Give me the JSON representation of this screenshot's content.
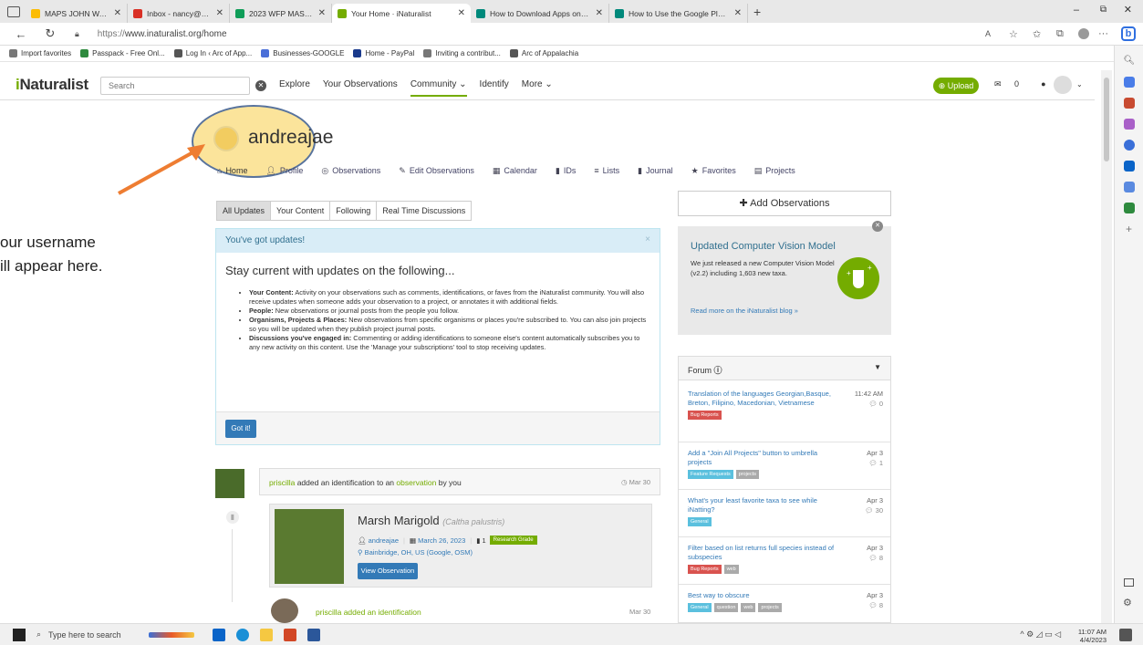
{
  "browser": {
    "tabs": [
      {
        "label": "MAPS JOHN WALSH - Google D",
        "color": "#fbbc04"
      },
      {
        "label": "Inbox - nancy@arcofappalachia.",
        "color": "#d93025"
      },
      {
        "label": "2023 WFP MASTER PLANNING",
        "color": "#0f9d58"
      },
      {
        "label": "Your Home · iNaturalist",
        "color": "#74ac00"
      },
      {
        "label": "How to Download Apps on Andr",
        "color": "#00897b"
      },
      {
        "label": "How to Use the Google Play Sto",
        "color": "#00897b"
      }
    ],
    "url_scheme": "https://",
    "url_rest": "www.inaturalist.org/home",
    "favorites": [
      "Import favorites",
      "Passpack - Free Onl...",
      "Log In ‹ Arc of App...",
      "Businesses-GOOGLE",
      "Home - PayPal",
      "Inviting a contribut...",
      "Arc of Appalachia"
    ]
  },
  "header": {
    "logo_i": "i",
    "logo_rest": "Naturalist",
    "search_placeholder": "Search",
    "nav": [
      "Explore",
      "Your Observations",
      "Community ⌄",
      "Identify",
      "More ⌄"
    ],
    "upload_label": "Upload",
    "messages_count": "0",
    "notifications_count": "0"
  },
  "profile": {
    "username": "andreajae",
    "subnav": [
      "Home",
      "Profile",
      "Observations",
      "Edit Observations",
      "Calendar",
      "IDs",
      "Lists",
      "Journal",
      "Favorites",
      "Projects"
    ]
  },
  "annotation": {
    "line1": "our username",
    "line2": "ill appear here."
  },
  "updates": {
    "tabs": [
      "All Updates",
      "Your Content",
      "Following",
      "Real Time Discussions"
    ],
    "header": "You've got updates!",
    "title": "Stay current with updates on the following...",
    "items": [
      {
        "bold": "Your Content:",
        "text": " Activity on your observations such as comments, identifications, or faves from the iNaturalist community. You will also receive updates when someone adds your observation to a project, or annotates it with additional fields."
      },
      {
        "bold": "People:",
        "text": " New observations or journal posts from the people you follow."
      },
      {
        "bold": "Organisms, Projects & Places:",
        "text": " New observations from specific organisms or places you're subscribed to. You can also join projects so you will be updated when they publish project journal posts."
      },
      {
        "bold": "Discussions you've engaged in:",
        "text": " Commenting or adding identifications to someone else's content automatically subscribes you to any new activity on this content. Use the 'Manage your subscriptions' tool to stop receiving updates."
      }
    ],
    "button": "Got it!"
  },
  "feed": {
    "item1": {
      "user": "priscilla",
      "mid": " added an identification to an ",
      "link": "observation",
      "end": " by you",
      "date": "Mar 30"
    },
    "obs": {
      "name": "Marsh Marigold",
      "sci": "(Caltha palustris)",
      "user": "andreajae",
      "date": "March 26, 2023",
      "ids": "1",
      "grade": "Research Grade",
      "place": "Bainbridge, OH, US (Google, OSM)",
      "button": "View Observation"
    },
    "item2": {
      "text": "priscilla added an identification",
      "date": "Mar 30"
    }
  },
  "right": {
    "add_obs": "Add Observations",
    "cv": {
      "title": "Updated Computer Vision Model",
      "text": "We just released a new Computer Vision Model (v2.2) including 1,603 new taxa.",
      "link": "Read more on the iNaturalist blog »"
    },
    "forum_title": "Forum",
    "posts": [
      {
        "title": "Translation of the languages Georgian,Basque, Breton, Filipino, Macedonian, Vietnamese",
        "date": "11:42 AM",
        "count": "0",
        "tags": [
          {
            "t": "Bug Reports",
            "c": "bug"
          }
        ]
      },
      {
        "title": "Add a \"Join All Projects\" button to umbrella projects",
        "date": "Apr 3",
        "count": "1",
        "tags": [
          {
            "t": "Feature Requests",
            "c": "feat"
          },
          {
            "t": "projects",
            "c": "gray"
          }
        ]
      },
      {
        "title": "What's your least favorite taxa to see while iNatting?",
        "date": "Apr 3",
        "count": "30",
        "tags": [
          {
            "t": "General",
            "c": "gen"
          }
        ]
      },
      {
        "title": "Filter based on list returns full species instead of subspecies",
        "date": "Apr 3",
        "count": "8",
        "tags": [
          {
            "t": "Bug Reports",
            "c": "bug"
          },
          {
            "t": "web",
            "c": "gray"
          }
        ]
      },
      {
        "title": "Best way to obscure",
        "date": "Apr 3",
        "count": "8",
        "tags": [
          {
            "t": "General",
            "c": "gen"
          },
          {
            "t": "question",
            "c": "gray"
          },
          {
            "t": "web",
            "c": "gray"
          },
          {
            "t": "projects",
            "c": "gray"
          }
        ]
      }
    ]
  },
  "taskbar": {
    "search": "Type here to search",
    "time": "11:07 AM",
    "date": "4/4/2023"
  },
  "colors": {
    "brand": "#74ac00",
    "link": "#337ab7",
    "highlight": "#fbe08a",
    "arrow": "#ee7d32"
  }
}
